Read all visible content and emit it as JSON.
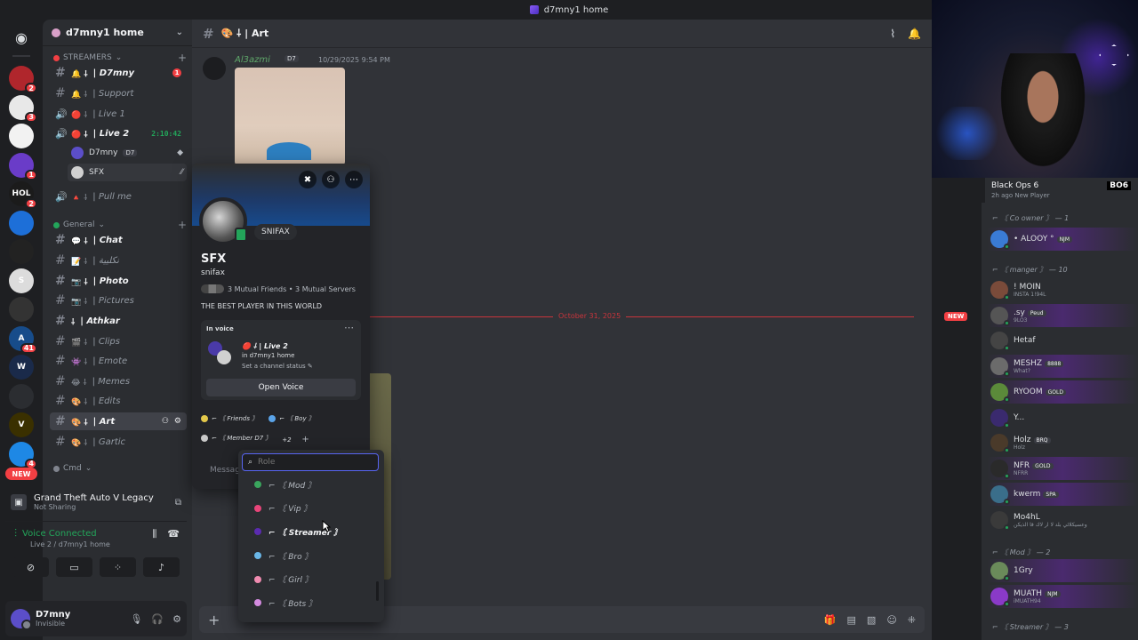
{
  "window": {
    "title": "d7mny1 home"
  },
  "rail": {
    "servers": [
      {
        "color": "#b0262c",
        "badge": "2",
        "label": ""
      },
      {
        "color": "#e8e8e8",
        "badge": "3",
        "label": ""
      },
      {
        "color": "#f2f2f2",
        "badge": "",
        "label": ""
      },
      {
        "color": "#6a3cc8",
        "badge": "1",
        "label": ""
      },
      {
        "color": "#1b1b1b",
        "badge": "2",
        "label": "HOL"
      },
      {
        "color": "#1d6fd8",
        "badge": "",
        "label": ""
      },
      {
        "color": "#222",
        "badge": "",
        "label": ""
      },
      {
        "color": "#dcdcdc",
        "badge": "",
        "label": "S"
      },
      {
        "color": "#333",
        "badge": "",
        "label": ""
      },
      {
        "color": "#174c8a",
        "badge": "41",
        "label": "A"
      },
      {
        "color": "#1a2a4a",
        "badge": "",
        "label": "W"
      },
      {
        "color": "#2b2d31",
        "badge": "",
        "label": ""
      },
      {
        "color": "#3a3000",
        "badge": "",
        "label": "V"
      },
      {
        "color": "#1e88e5",
        "badge": "4",
        "label": ""
      }
    ],
    "new_label": "NEW"
  },
  "guild": {
    "name": "d7mny1 home"
  },
  "categories": {
    "streamers": "STREAMERS",
    "general": "General",
    "cmd": "Cmd"
  },
  "channels": [
    {
      "type": "text",
      "icons": "🔔 ⸸",
      "name": "| D7mny",
      "unread": true,
      "mention": "1"
    },
    {
      "type": "text",
      "icons": "🔔 ⸸",
      "name": "| Support",
      "unread": false
    },
    {
      "type": "voice",
      "icons": "🔴 ⸸",
      "name": "| Live 1",
      "unread": false
    },
    {
      "type": "voice",
      "icons": "🔴 ⸸",
      "name": "| Live 2",
      "unread": true,
      "timer": "2:10:42"
    },
    {
      "type": "voice",
      "icons": "🔺 ⸸",
      "name": "| Pull me",
      "unread": false
    },
    {
      "type": "text",
      "icons": "💬 ⸸",
      "name": "| Chat",
      "unread": true
    },
    {
      "type": "text",
      "icons": "📝 ⸸",
      "name": "| نكليية",
      "unread": false
    },
    {
      "type": "text",
      "icons": "📷 ⸸",
      "name": "| Photo",
      "unread": true
    },
    {
      "type": "text",
      "icons": "📷 ⸸",
      "name": "| Pictures",
      "unread": false
    },
    {
      "type": "text",
      "icons": "⸸",
      "name": "| Athkar",
      "unread": true
    },
    {
      "type": "text",
      "icons": "🎬 ⸸",
      "name": "| Clips",
      "unread": false
    },
    {
      "type": "text",
      "icons": "👾 ⸸",
      "name": "| Emote",
      "unread": false
    },
    {
      "type": "text",
      "icons": "😂 ⸸",
      "name": "| Memes",
      "unread": false
    },
    {
      "type": "text",
      "icons": "🎨 ⸸",
      "name": "| Edits",
      "unread": false
    },
    {
      "type": "text",
      "icons": "🎨 ⸸",
      "name": "| Art",
      "active": true
    },
    {
      "type": "text",
      "icons": "🎨 ⸸",
      "name": "| Gartic",
      "unread": false
    }
  ],
  "voice_users": [
    {
      "name": "D7mny",
      "tag": "D7"
    },
    {
      "name": "SFX",
      "tag": ""
    }
  ],
  "activity": {
    "game": "Grand Theft Auto V Legacy",
    "status": "Not Sharing"
  },
  "voice_panel": {
    "title": "Voice Connected",
    "sub": "Live 2 / d7mny1 home"
  },
  "user_panel": {
    "name": "D7mny",
    "status": "Invisible"
  },
  "header": {
    "channel": "🎨 ⸸ | Art"
  },
  "message": {
    "author": "Al3azmi",
    "tag": "D7",
    "time": "10/29/2025 9:54 PM"
  },
  "divider": {
    "label": "October 31, 2025",
    "new": "NEW"
  },
  "composer": {
    "placeholder": "Message"
  },
  "profile": {
    "nick_bubble": "SNIFAX",
    "display_name": "SFX",
    "username": "snifax",
    "mutual": "3 Mutual Friends • 3 Mutual Servers",
    "bio": "THE BEST  PLAYER IN THIS WORLD",
    "voice_header": "In voice",
    "voice_channel": "🔴 ⸸ | Live 2",
    "voice_location": "in d7mny1 home",
    "voice_status": "Set a channel status ✎",
    "open_voice": "Open Voice",
    "roles": [
      {
        "name": "⌐ 〘 Friends 〙",
        "color": "#e3c84a"
      },
      {
        "name": "⌐ 〘 Boy 〙",
        "color": "#5aa3e8"
      },
      {
        "name": "⌐ 〘 Member D7 〙",
        "color": "#c9c9c9"
      }
    ],
    "roles_more": "+2",
    "message_placeholder": "Message"
  },
  "role_menu": {
    "placeholder": "Role",
    "items": [
      {
        "name": "⌐ 〘 Mod 〙",
        "color": "#3aa55d"
      },
      {
        "name": "⌐ 〘 Vip 〙",
        "color": "#e8457a"
      },
      {
        "name": "⌐ 〘 Streamer 〙",
        "color": "#5b2bb0",
        "hover": true
      },
      {
        "name": "⌐ 〘 Bro 〙",
        "color": "#6ab7e8"
      },
      {
        "name": "⌐ 〘 Girl 〙",
        "color": "#f08bb0"
      },
      {
        "name": "⌐ 〘 Bots 〙",
        "color": "#d48be0"
      }
    ]
  },
  "game_banner": {
    "title": "Black Ops 6",
    "sub": "2h ago  New Player",
    "logo": "BO6"
  },
  "member_groups": {
    "co_owner": "⌐ 〘 Co owner 〙 — 1",
    "manger": "⌐ 〘 manger 〙 — 10",
    "mod": "⌐ 〘 Mod 〙 — 2",
    "streamer": "⌐ 〘 Streamer 〙 — 3"
  },
  "members": [
    {
      "name": "• ALOOY °",
      "tag": "NJM",
      "sub": "",
      "color": "#3a7bd5",
      "hl": true
    },
    {
      "name": "! MOIN",
      "tag": "",
      "sub": "INSTA 1!94L",
      "color": "#7a4b3a",
      "hl": false
    },
    {
      "name": ".sy",
      "tag": "Peud",
      "sub": "9LO3",
      "color": "#555",
      "hl": true
    },
    {
      "name": "Hetaf",
      "tag": "",
      "sub": "",
      "color": "#444",
      "hl": false
    },
    {
      "name": "MESHZ",
      "tag": "8888",
      "sub": "What?",
      "color": "#6b6b6b",
      "hl": true
    },
    {
      "name": "RYOOM",
      "tag": "GOLD",
      "sub": "",
      "color": "#5b8a3a",
      "hl": true
    },
    {
      "name": "Y...",
      "tag": "",
      "sub": "",
      "color": "#3a2a6e",
      "hl": false
    },
    {
      "name": "Holz",
      "tag": "BRQ",
      "sub": "Holz",
      "color": "#4a3a2a",
      "hl": false
    },
    {
      "name": "NFR",
      "tag": "GOLD",
      "sub": "NFRR",
      "color": "#2a2a2a",
      "hl": true
    },
    {
      "name": "kwerm",
      "tag": "SPA",
      "sub": "",
      "color": "#3a6e8a",
      "hl": true
    },
    {
      "name": "Mo4hL",
      "tag": "",
      "sub": "وعسيكلائي بلد لا ار لاك قا الذيكن",
      "color": "#3a3a3a",
      "hl": false
    },
    {
      "name": "1Gry",
      "tag": "",
      "sub": "",
      "color": "#6a8a5a",
      "hl": true
    },
    {
      "name": "MUATH",
      "tag": "NJM",
      "sub": "iMUATH94",
      "color": "#8a3ac8",
      "hl": true
    }
  ]
}
